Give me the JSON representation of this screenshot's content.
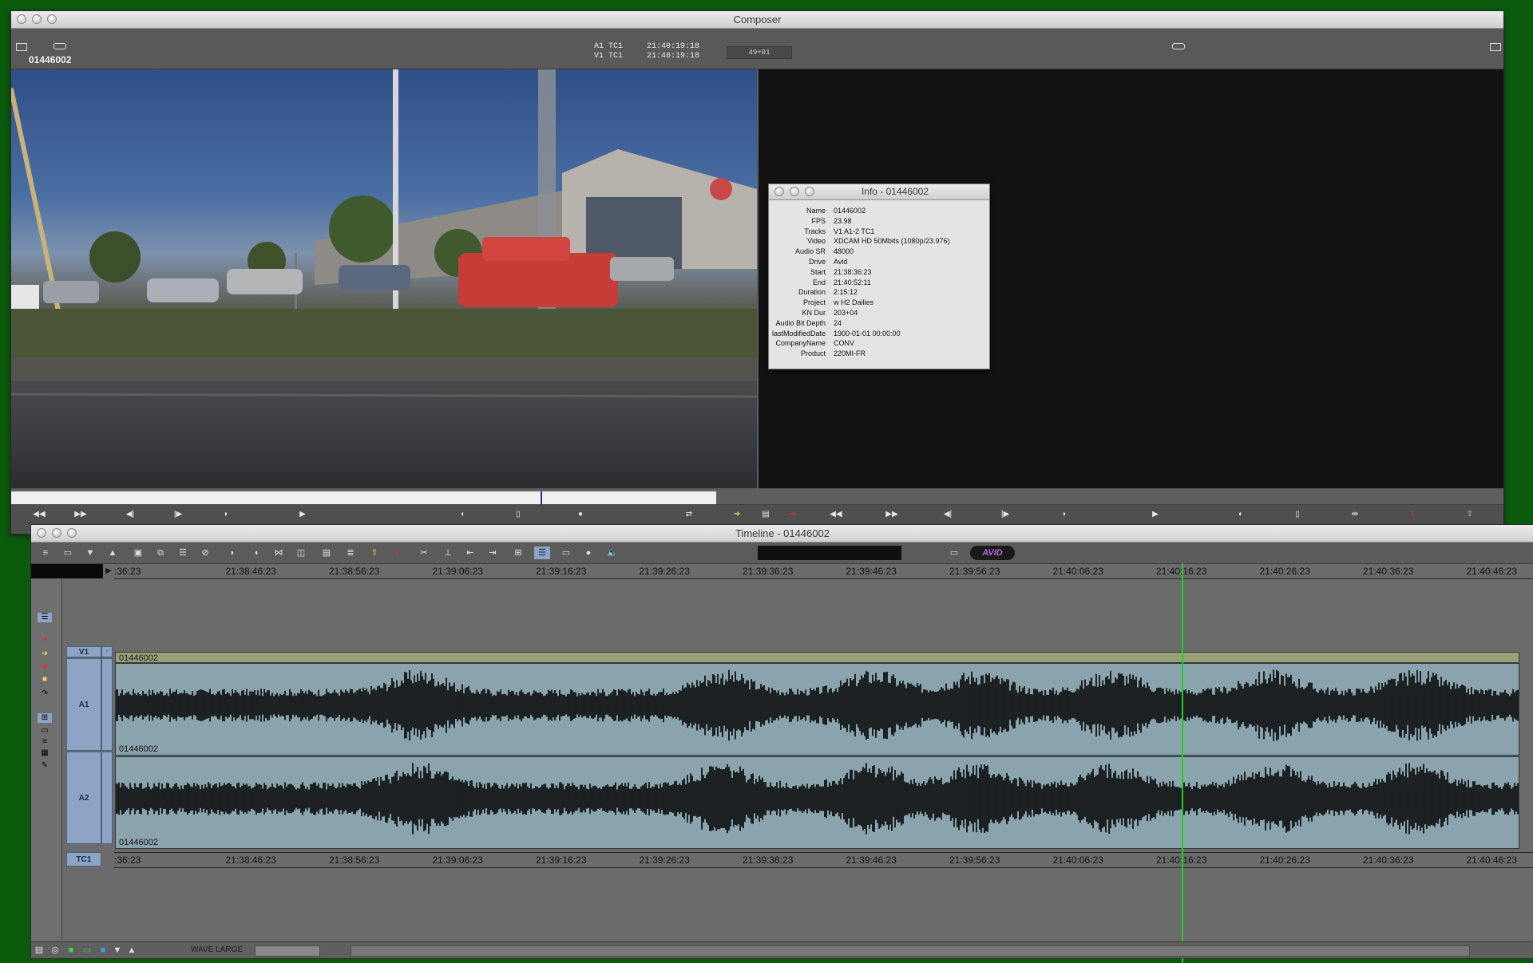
{
  "composer": {
    "title": "Composer",
    "clip_name": "01446002",
    "tc_rows": [
      {
        "label": "A1 TC1",
        "value": "21:40:19:18"
      },
      {
        "label": "V1 TC1",
        "value": "21:40:19:18"
      }
    ],
    "counter": "49+01"
  },
  "info": {
    "title": "Info - 01446002",
    "rows": [
      {
        "k": "Name",
        "v": "01446002"
      },
      {
        "k": "FPS",
        "v": "23.98"
      },
      {
        "k": "Tracks",
        "v": "V1 A1-2 TC1"
      },
      {
        "k": "Video",
        "v": "XDCAM HD 50Mbits (1080p/23.976)"
      },
      {
        "k": "Audio SR",
        "v": "48000"
      },
      {
        "k": "Drive",
        "v": "Avid"
      },
      {
        "k": "Start",
        "v": "21:38:36:23"
      },
      {
        "k": "End",
        "v": "21:40:52:11"
      },
      {
        "k": "Duration",
        "v": "2:15:12"
      },
      {
        "k": "Project",
        "v": "w H2 Dailies"
      },
      {
        "k": "KN Dur",
        "v": "203+04"
      },
      {
        "k": "Audio Bit Depth",
        "v": "24"
      },
      {
        "k": "lastModifiedDate",
        "v": "1900-01-01 00:00:00"
      },
      {
        "k": "CompanyName",
        "v": "CONV"
      },
      {
        "k": "Product",
        "v": "220MI-FR"
      }
    ]
  },
  "timeline": {
    "title": "Timeline - 01446002",
    "ruler": [
      ":36:23",
      "21:38:46:23",
      "21:38:56:23",
      "21:39:06:23",
      "21:39:16:23",
      "21:39:26:23",
      "21:39:36:23",
      "21:39:46:23",
      "21:39:56:23",
      "21:40:06:23",
      "21:40:16:23",
      "21:40:26:23",
      "21:40:36:23",
      "21:40:46:23"
    ],
    "tracks": {
      "v1": "V1",
      "a1": "A1",
      "a2": "A2",
      "tc1": "TC1"
    },
    "clip_name": "01446002",
    "status_label": "WAVE LARGE",
    "logo": "AVID"
  },
  "icons": {
    "transport": [
      "rewind-icon",
      "fast-forward-icon",
      "step-back-icon",
      "step-forward-icon",
      "mark-in-icon",
      "play-icon",
      "mark-out-icon",
      "clear-marks-icon"
    ]
  }
}
